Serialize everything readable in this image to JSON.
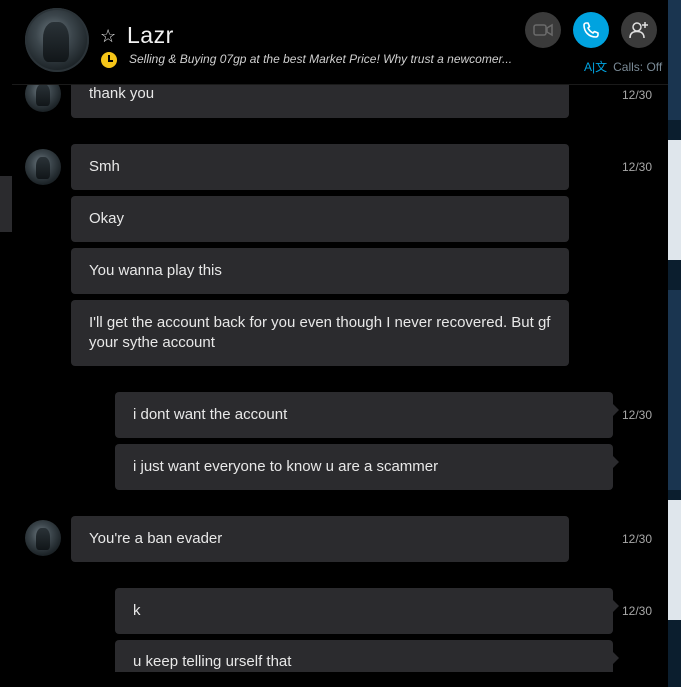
{
  "contact": {
    "name": "Lazr",
    "mood": "Selling & Buying 07gp at the best Market Price! Why trust a newcomer...",
    "calls_status": "Calls: Off",
    "ax_label": "A|文"
  },
  "header_buttons": {
    "video": "video-call",
    "call": "audio-call",
    "add": "add-people"
  },
  "messages": [
    {
      "from": "contact",
      "text": "thank you",
      "time": "12/30"
    },
    {
      "from": "contact",
      "text": "Smh",
      "time": "12/30"
    },
    {
      "from": "contact",
      "text": "Okay",
      "time": ""
    },
    {
      "from": "contact",
      "text": "You wanna play this",
      "time": ""
    },
    {
      "from": "contact",
      "text": "I'll get the account back for you even though I never recovered. But gf your sythe account",
      "time": ""
    },
    {
      "from": "me",
      "text": "i dont want the account",
      "time": "12/30"
    },
    {
      "from": "me",
      "text": "i just want everyone to know u are a scammer",
      "time": ""
    },
    {
      "from": "contact",
      "text": "You're a ban evader",
      "time": "12/30"
    },
    {
      "from": "me",
      "text": "k",
      "time": "12/30"
    },
    {
      "from": "me",
      "text": "u keep telling urself that",
      "time": ""
    }
  ],
  "colors": {
    "accent": "#00a3e0",
    "bubble": "#2b2b2e",
    "background": "#000000",
    "mood_icon": "#f5c518"
  }
}
